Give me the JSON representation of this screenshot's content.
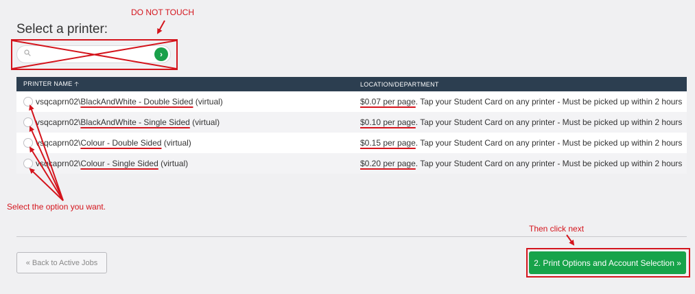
{
  "page": {
    "title": "Select a printer:"
  },
  "search": {
    "placeholder": "",
    "go_icon": "chevron-right-icon",
    "icon": "search-icon"
  },
  "table": {
    "columns": {
      "name": "PRINTER NAME",
      "sort_indicator": "🡡",
      "location": "LOCATION/DEPARTMENT"
    },
    "rows": [
      {
        "server": "vsqcaprn02\\",
        "queue": "BlackAndWhite - Double Sided",
        "suffix": " (virtual)",
        "price": "$0.07 per page",
        "note": ". Tap your Student Card on any printer - Must be picked up within 2 hours"
      },
      {
        "server": "vsqcaprn02\\",
        "queue": "BlackAndWhite - Single Sided",
        "suffix": " (virtual)",
        "price": "$0.10 per page",
        "note": ". Tap your Student Card on any printer - Must be picked up within 2 hours"
      },
      {
        "server": "vsqcaprn02\\",
        "queue": "Colour - Double Sided",
        "suffix": " (virtual)",
        "price": "$0.15 per page",
        "note": ". Tap your Student Card on any printer - Must be picked up within 2 hours"
      },
      {
        "server": "vsqcaprn02\\",
        "queue": "Colour - Single Sided",
        "suffix": " (virtual)",
        "price": "$0.20 per page",
        "note": ". Tap your Student Card on any printer - Must be picked up within 2 hours"
      }
    ]
  },
  "buttons": {
    "back": "« Back to Active Jobs",
    "next": "2. Print Options and Account Selection »"
  },
  "annotations": {
    "do_not_touch": "DO NOT TOUCH",
    "select_option": "Select the option you want.",
    "then_click_next": "Then click next"
  },
  "colors": {
    "accent_green": "#17a34a",
    "header_dark": "#2c3e50",
    "annotation_red": "#d4141c"
  }
}
